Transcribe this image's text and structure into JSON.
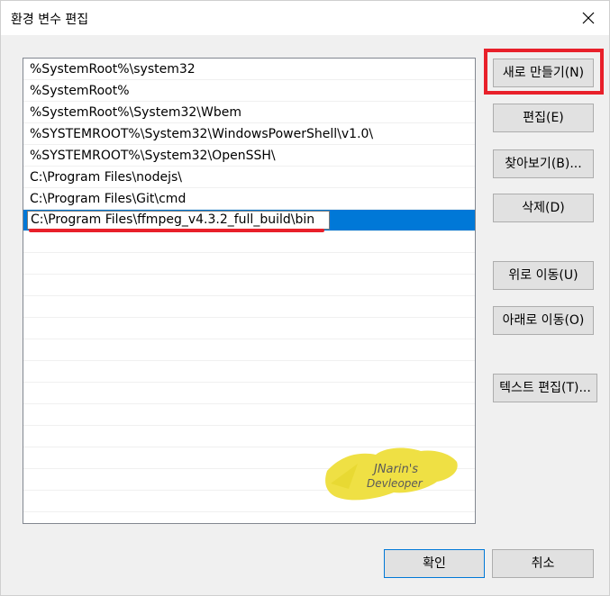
{
  "window": {
    "title": "환경 변수 편집",
    "close_glyph": "close-icon"
  },
  "paths": [
    "%SystemRoot%\\system32",
    "%SystemRoot%",
    "%SystemRoot%\\System32\\Wbem",
    "%SYSTEMROOT%\\System32\\WindowsPowerShell\\v1.0\\",
    "%SYSTEMROOT%\\System32\\OpenSSH\\",
    "C:\\Program Files\\nodejs\\",
    "C:\\Program Files\\Git\\cmd",
    "C:\\Program Files\\ffmpeg_v4.3.2_full_build\\bin"
  ],
  "selected_index": 7,
  "buttons": {
    "new": "새로 만들기(N)",
    "edit": "편집(E)",
    "browse": "찾아보기(B)...",
    "delete": "삭제(D)",
    "move_up": "위로 이동(U)",
    "move_down": "아래로 이동(O)",
    "edit_text": "텍스트 편집(T)...",
    "ok": "확인",
    "cancel": "취소"
  },
  "watermark": {
    "line1": "JNarin's",
    "line2": "Devleoper"
  },
  "colors": {
    "selection": "#0078d7",
    "annotation_red": "#e8202a",
    "watermark_yellow": "#efe044"
  }
}
